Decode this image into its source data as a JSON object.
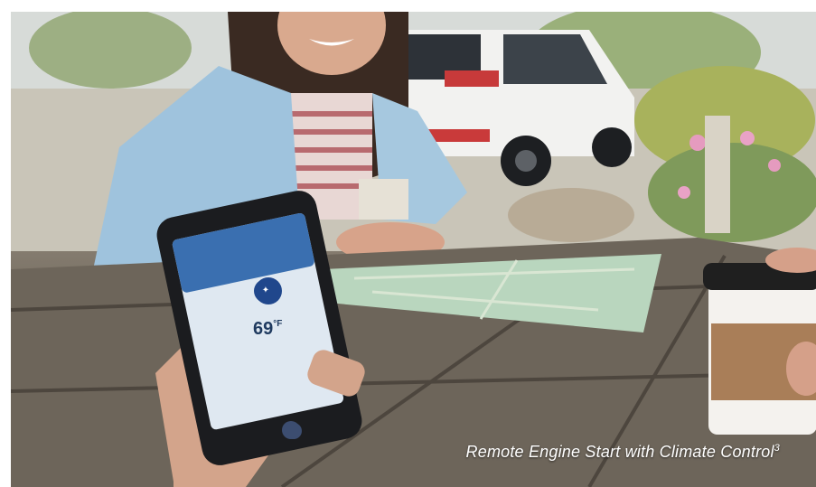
{
  "caption": {
    "text": "Remote Engine Start with Climate Control",
    "superscript": "3"
  },
  "phone_app": {
    "temperature": "69",
    "unit": "°F"
  },
  "colors": {
    "caption": "#ffffff",
    "table_wood": "#6d655a",
    "car": "#f3f3f1",
    "shirt": "#9fc3dd",
    "map": "#b9d6be",
    "coffee_sleeve": "#a97e58"
  },
  "icons": {
    "app_logo": "subaru-star-logo-icon",
    "home_button": "home-button-icon"
  }
}
